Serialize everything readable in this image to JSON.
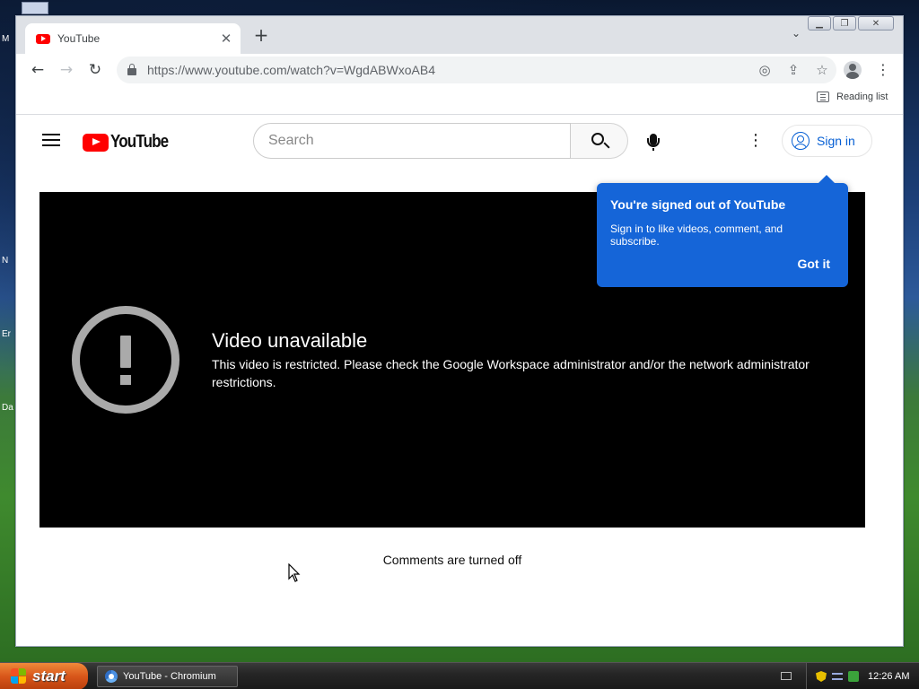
{
  "desktop": {
    "icon_labels": [
      "M",
      "N",
      "Er",
      "Da"
    ]
  },
  "browser": {
    "tab": {
      "title": "YouTube"
    },
    "new_tab_symbol": "+",
    "url": "https://www.youtube.com/watch?v=WgdABWxoAB4",
    "reading_list_label": "Reading list"
  },
  "youtube": {
    "logo_text": "YouTube",
    "search_placeholder": "Search",
    "signin_label": "Sign in",
    "video_error": {
      "title": "Video unavailable",
      "message": "This video is restricted. Please check the Google Workspace administrator and/or the network administrator restrictions."
    },
    "comments_status": "Comments are turned off",
    "signed_out_tooltip": {
      "title": "You're signed out of YouTube",
      "body": "Sign in to like videos, comment, and subscribe.",
      "button": "Got it"
    }
  },
  "taskbar": {
    "start_label": "start",
    "task_item": "YouTube - Chromium",
    "clock": "12:26 AM"
  },
  "colors": {
    "youtube_red": "#ff0000",
    "link_blue": "#065fd4",
    "tooltip_blue": "#1565d8",
    "player_bg": "#000000"
  }
}
